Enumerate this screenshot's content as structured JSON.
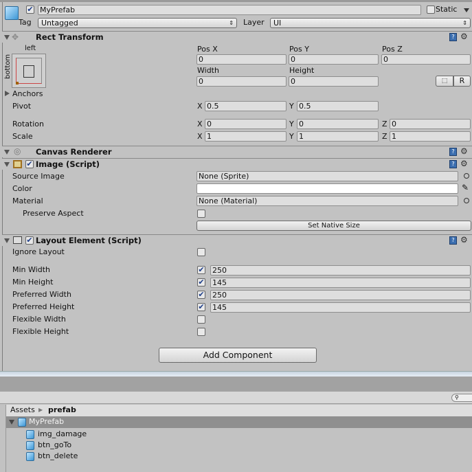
{
  "header": {
    "active": true,
    "name": "MyPrefab",
    "static_label": "Static",
    "static": false,
    "tag_label": "Tag",
    "tag_value": "Untagged",
    "layer_label": "Layer",
    "layer_value": "UI"
  },
  "rect_transform": {
    "title": "Rect Transform",
    "anchor_h": "left",
    "anchor_v": "bottom",
    "pos_x_label": "Pos X",
    "pos_y_label": "Pos Y",
    "pos_z_label": "Pos Z",
    "pos_x": "0",
    "pos_y": "0",
    "pos_z": "0",
    "width_label": "Width",
    "height_label": "Height",
    "width": "0",
    "height": "0",
    "blueprint_btn": "⬚",
    "raw_btn": "R",
    "anchors_label": "Anchors",
    "pivot_label": "Pivot",
    "pivot_x": "0.5",
    "pivot_y": "0.5",
    "rotation_label": "Rotation",
    "rot_x": "0",
    "rot_y": "0",
    "rot_z": "0",
    "scale_label": "Scale",
    "scale_x": "1",
    "scale_y": "1",
    "scale_z": "1",
    "x": "X",
    "y": "Y",
    "z": "Z"
  },
  "canvas_renderer": {
    "title": "Canvas Renderer"
  },
  "image": {
    "title": "Image (Script)",
    "enabled": true,
    "source_label": "Source Image",
    "source_value": "None (Sprite)",
    "color_label": "Color",
    "color_value": "#ffffff",
    "material_label": "Material",
    "material_value": "None (Material)",
    "preserve_label": "Preserve Aspect",
    "preserve": false,
    "native_btn": "Set Native Size"
  },
  "layout_element": {
    "title": "Layout Element (Script)",
    "enabled": true,
    "ignore_label": "Ignore Layout",
    "ignore": false,
    "rows": [
      {
        "label": "Min Width",
        "checked": true,
        "value": "250"
      },
      {
        "label": "Min Height",
        "checked": true,
        "value": "145"
      },
      {
        "label": "Preferred Width",
        "checked": true,
        "value": "250"
      },
      {
        "label": "Preferred Height",
        "checked": true,
        "value": "145"
      },
      {
        "label": "Flexible Width",
        "checked": false,
        "value": ""
      },
      {
        "label": "Flexible Height",
        "checked": false,
        "value": ""
      }
    ]
  },
  "add_component": "Add Component",
  "project": {
    "breadcrumb_root": "Assets",
    "breadcrumb_current": "prefab",
    "root": "MyPrefab",
    "children": [
      "img_damage",
      "btn_goTo",
      "btn_delete"
    ]
  }
}
